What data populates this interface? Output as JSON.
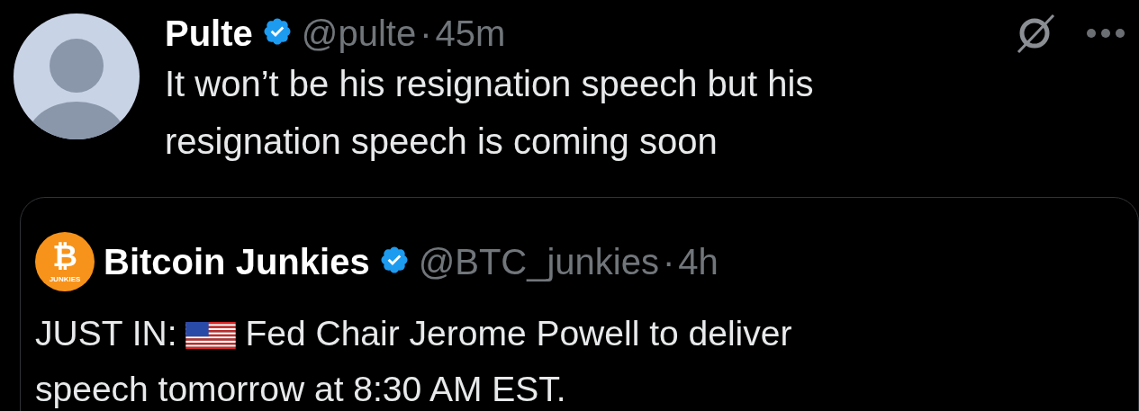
{
  "post": {
    "author": {
      "name": "Pulte",
      "verified": true,
      "handle": "@pulte",
      "separator": "·",
      "time": "45m"
    },
    "text": "It won’t be his resignation speech but his resignation speech is coming soon"
  },
  "quote": {
    "author": {
      "name": "Bitcoin Junkies",
      "verified": true,
      "handle": "@BTC_junkies",
      "separator": "·",
      "time": "4h",
      "logo": {
        "symbol": "₿",
        "caption": "JUNKIES"
      }
    },
    "lead": "JUST IN:",
    "text": "Fed Chair Jerome Powell to deliver speech tomorrow at 8:30 AM EST."
  }
}
